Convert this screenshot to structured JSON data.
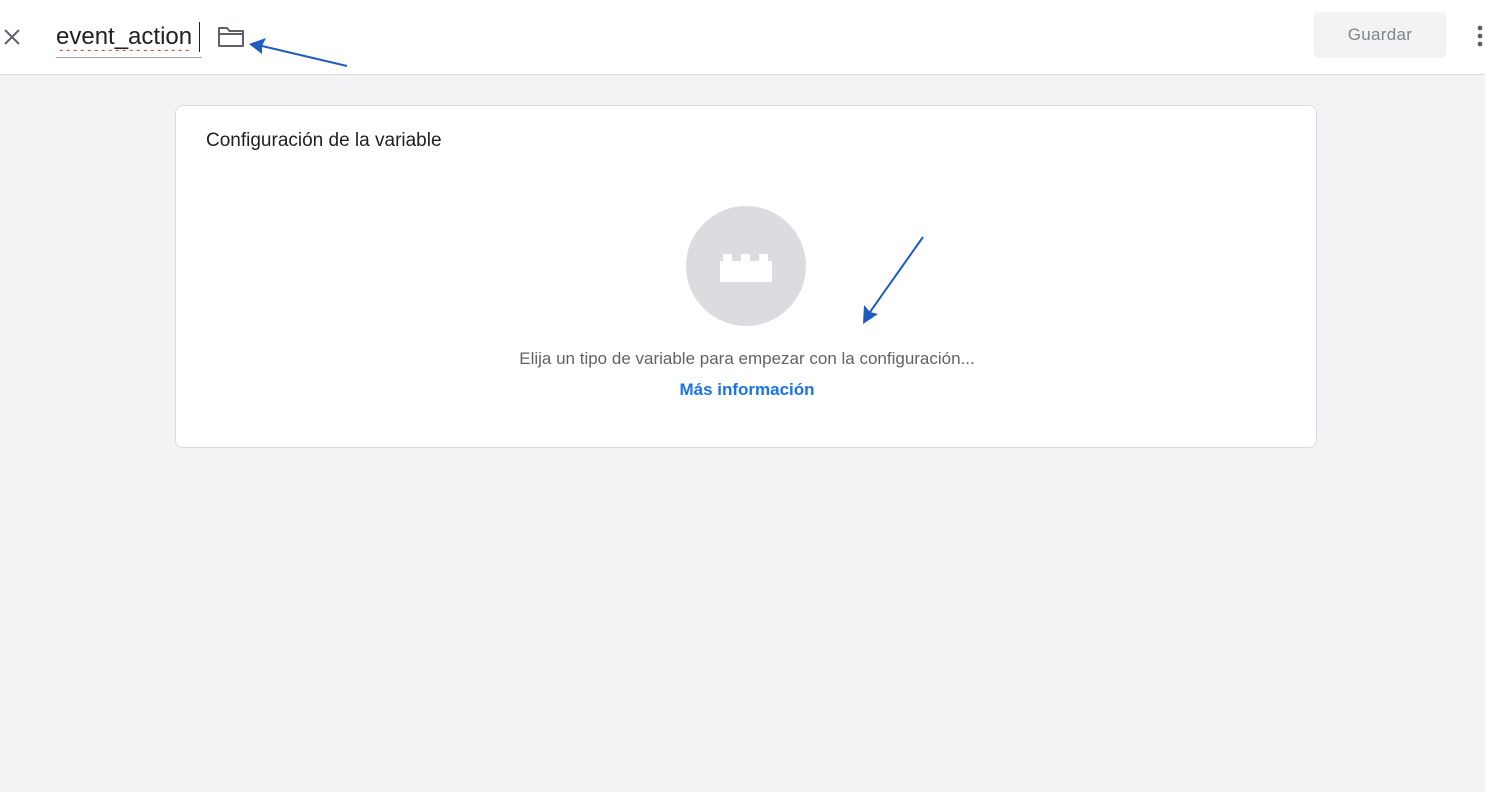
{
  "header": {
    "variable_name": "event_action",
    "save_label": "Guardar",
    "close_icon": "close-icon",
    "folder_icon": "folder-icon",
    "more_icon": "more-vert-icon"
  },
  "card": {
    "title": "Configuración de la variable",
    "placeholder_icon": "lego-block-icon",
    "hint": "Elija un tipo de variable para empezar con la configuración...",
    "learn_more": "Más información"
  },
  "colors": {
    "background": "#f1f3f4",
    "link": "#1a73e8",
    "annotation_arrow": "#1f5bbf",
    "placeholder_circle": "#dadce0"
  }
}
